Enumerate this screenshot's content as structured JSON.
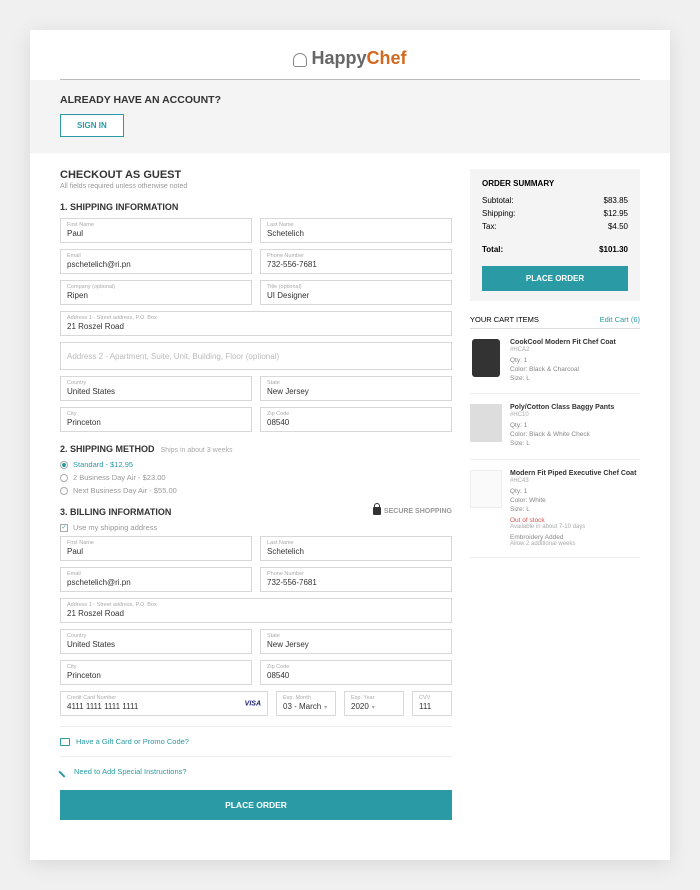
{
  "logo": {
    "part1": "Happy",
    "part2": "Chef"
  },
  "account": {
    "title": "ALREADY HAVE AN ACCOUNT?",
    "signin": "SIGN IN"
  },
  "guest": {
    "title": "CHECKOUT AS GUEST",
    "sub": "All fields required unless otherwise noted"
  },
  "ship": {
    "title": "1. SHIPPING INFORMATION",
    "fname_lbl": "First Name",
    "fname": "Paul",
    "lname_lbl": "Last Name",
    "lname": "Schetelich",
    "email_lbl": "Email",
    "email": "pschetelich@ri.pn",
    "phone_lbl": "Phone Number",
    "phone": "732-556-7681",
    "company_lbl": "Company (optional)",
    "company": "Ripen",
    "title_lbl": "Title (optional)",
    "title_val": "UI Designer",
    "addr1_lbl": "Address 1 - Street address, P.O. Box",
    "addr1": "21 Roszel Road",
    "addr2_ph": "Address 2 - Apartment, Suite, Unit, Building, Floor (optional)",
    "country_lbl": "Country",
    "country": "United States",
    "state_lbl": "State",
    "state": "New Jersey",
    "city_lbl": "City",
    "city": "Princeton",
    "zip_lbl": "Zip Code",
    "zip": "08540"
  },
  "method": {
    "title": "2. SHIPPING METHOD",
    "ships": "Ships in about 3 weeks",
    "opt1": "Standard  -  $12.95",
    "opt2": "2 Business Day Air  -  $23.00",
    "opt3": "Next Business Day Air  -  $55.00"
  },
  "bill": {
    "title": "3. BILLING INFORMATION",
    "secure": "SECURE SHOPPING",
    "use_ship": "Use my shipping address",
    "fname_lbl": "First Name",
    "fname": "Paul",
    "lname_lbl": "Last Name",
    "lname": "Schetelich",
    "email_lbl": "Email",
    "email": "pschetelich@ri.pn",
    "phone_lbl": "Phone Number",
    "phone": "732-556-7681",
    "addr1_lbl": "Address 1 - Street address, P.O. Box",
    "addr1": "21 Roszel Road",
    "country_lbl": "Country",
    "country": "United States",
    "state_lbl": "State",
    "state": "New Jersey",
    "city_lbl": "City",
    "city": "Princeton",
    "zip_lbl": "Zip Code",
    "zip": "08540",
    "card_lbl": "Credit Card Number",
    "card": "4111 1111 1111 1111",
    "card_type": "VISA",
    "mo_lbl": "Exp. Month",
    "mo": "03 - March",
    "yr_lbl": "Exp. Year",
    "yr": "2020",
    "cvv_lbl": "CVV",
    "cvv": "111"
  },
  "links": {
    "promo": "Have a Gift Card or Promo Code?",
    "instr": "Need to Add Special Instructions?"
  },
  "place_order": "PLACE ORDER",
  "summary": {
    "title": "ORDER SUMMARY",
    "subtotal_lbl": "Subtotal:",
    "subtotal": "$83.85",
    "shipping_lbl": "Shipping:",
    "shipping": "$12.95",
    "tax_lbl": "Tax:",
    "tax": "$4.50",
    "total_lbl": "Total:",
    "total": "$101.30"
  },
  "cart": {
    "title": "YOUR CART ITEMS",
    "edit": "Edit Cart (6)",
    "items": [
      {
        "name": "CookCool Modern Fit Chef Coat",
        "sku": "#HCA2",
        "qty": "Qty: 1",
        "color": "Color: Black & Charcoal",
        "size": "Size: L"
      },
      {
        "name": "Poly/Cotton Class Baggy Pants",
        "sku": "#HC10",
        "qty": "Qty: 1",
        "color": "Color: Black & White Check",
        "size": "Size: L"
      },
      {
        "name": "Modern Fit Piped Executive Chef Coat",
        "sku": "#HC43",
        "qty": "Qty: 1",
        "color": "Color: White",
        "size": "Size: L",
        "oos": "Out of stock",
        "avail": "Available in about 7-10 days",
        "emb": "Embroidery Added",
        "emb2": "Allow 2 additional weeks"
      }
    ]
  }
}
